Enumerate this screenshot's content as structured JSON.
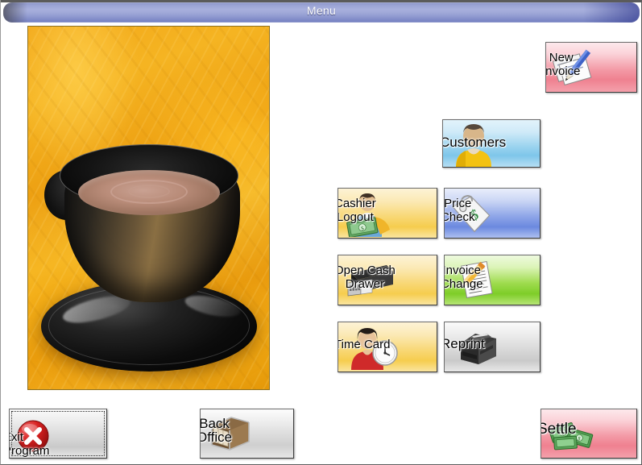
{
  "window": {
    "title": "Menu",
    "background_color": "#ffffff",
    "titlebar_color": "#9aa3d4"
  },
  "photo": {
    "name": "coffee-cup-photo",
    "alt": "Black coffee cup and saucer on orange cloth"
  },
  "buttons": [
    {
      "id": "new-invoice",
      "label": "New\nInvoice",
      "icon": "invoice-pen-icon",
      "color": "#f39aa6"
    },
    {
      "id": "customers",
      "label": "Customers",
      "icon": "user-icon",
      "color": "#9cd4ef"
    },
    {
      "id": "cashier-logout",
      "label": "Cashier\nLogout",
      "icon": "cashier-money-icon",
      "color": "#f8d877"
    },
    {
      "id": "price-check",
      "label": "Price\nCheck",
      "icon": "price-tag-icon",
      "color": "#8fa6e8"
    },
    {
      "id": "open-cash-drawer",
      "label": "Open Cash\nDrawer",
      "icon": "cash-drawer-icon",
      "color": "#f8d877"
    },
    {
      "id": "invoice-change",
      "label": "Invoice\nChange",
      "icon": "pencil-document-icon",
      "color": "#9fdc4f"
    },
    {
      "id": "time-card",
      "label": "Time Card",
      "icon": "person-clock-icon",
      "color": "#f8d877"
    },
    {
      "id": "reprint",
      "label": "Reprint",
      "icon": "receipt-printer-icon",
      "color": "#d8d8d8"
    },
    {
      "id": "exit-program",
      "label": "Exit\nProgram",
      "icon": "red-x-circle-icon",
      "color": "#d8d8d8",
      "focused": true
    },
    {
      "id": "back-office",
      "label": "Back\nOffice",
      "icon": "file-box-icon",
      "color": "#dcdcdc"
    },
    {
      "id": "settle",
      "label": "Settle",
      "icon": "cash-money-icon",
      "color": "#f39aa6"
    }
  ]
}
